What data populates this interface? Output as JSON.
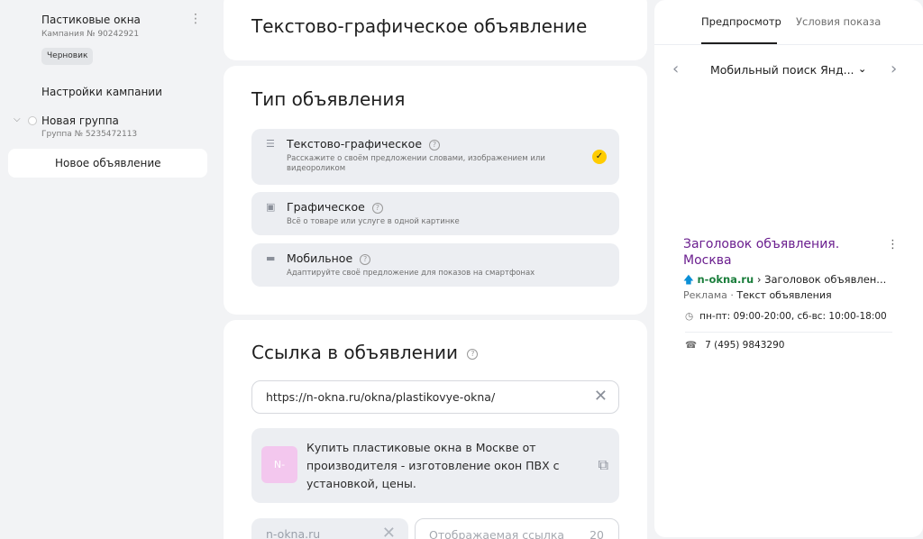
{
  "sidebar": {
    "campaign_title": "Пастиковые окна",
    "campaign_sub": "Кампания № 90242921",
    "badge": "Черновик",
    "settings_link": "Настройки кампании",
    "group_title": "Новая группа",
    "group_sub": "Группа № 5235472113",
    "ad_item": "Новое объявление"
  },
  "header": {
    "title": "Текстово-графическое объявление"
  },
  "ad_type": {
    "title": "Тип объявления",
    "options": [
      {
        "name": "Текстово-графическое",
        "desc": "Расскажите о своём предложении словами, изображением или видеороликом",
        "selected": true
      },
      {
        "name": "Графическое",
        "desc": "Всё о товаре или услуге в одной картинке",
        "selected": false
      },
      {
        "name": "Мобильное",
        "desc": "Адаптируйте своё предложение для показов на смартфонах",
        "selected": false
      }
    ]
  },
  "link": {
    "title": "Ссылка в объявлении",
    "url": "https://n-okna.ru/okna/plastikovye-okna/",
    "favicon_text": "N-",
    "site_title": "Купить пластиковые окна в Москве от производителя - изготовление окон ПВХ с установкой, цены.",
    "domain": "n-okna.ru",
    "display_placeholder": "Отображаемая ссылка",
    "display_counter": "20"
  },
  "preview": {
    "tabs": [
      "Предпросмотр",
      "Условия показа"
    ],
    "device": "Мобильный поиск Янд...",
    "ad_title": "Заголовок объявления. Москва",
    "domain": "n-okna.ru",
    "path": "Заголовок объявлен...",
    "label": "Реклама",
    "text": "Текст объявления",
    "hours": "пн-пт: 09:00-20:00, сб-вс: 10:00-18:00",
    "phone": "7 (495) 9843290"
  },
  "colors": {
    "accent": "#ffcc00",
    "ad_title": "#6b1f8f",
    "ad_domain": "#1b7e3c",
    "background": "#f2f3f5"
  }
}
